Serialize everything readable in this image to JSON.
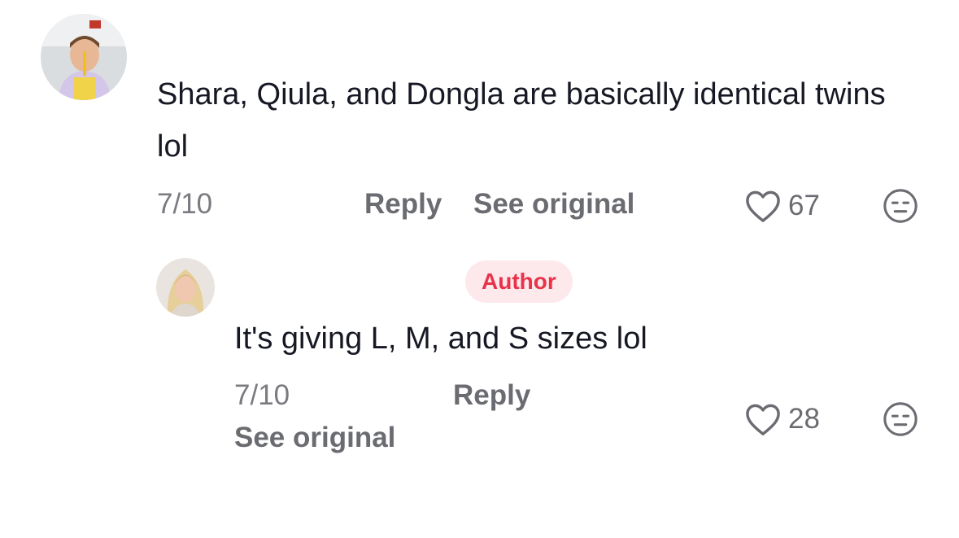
{
  "comment": {
    "avatar_icon": "user-avatar-child-photo",
    "text": "Shara, Qiula, and Dongla are basically identical twins lol",
    "date": "7/10",
    "reply_label": "Reply",
    "see_original_label": "See original",
    "like_icon": "heart-outline-icon",
    "like_count": "67",
    "dislike_icon": "meh-face-icon"
  },
  "reply": {
    "avatar_icon": "user-avatar-blonde-photo",
    "author_badge": "Author",
    "text": "It's giving L, M, and S sizes lol",
    "date": "7/10",
    "reply_label": "Reply",
    "see_original_label": "See original",
    "like_icon": "heart-outline-icon",
    "like_count": "28",
    "dislike_icon": "meh-face-icon"
  },
  "colors": {
    "text": "#161823",
    "muted": "#7a7b80",
    "badge_bg": "#fde8ec",
    "badge_text": "#e8334a"
  }
}
